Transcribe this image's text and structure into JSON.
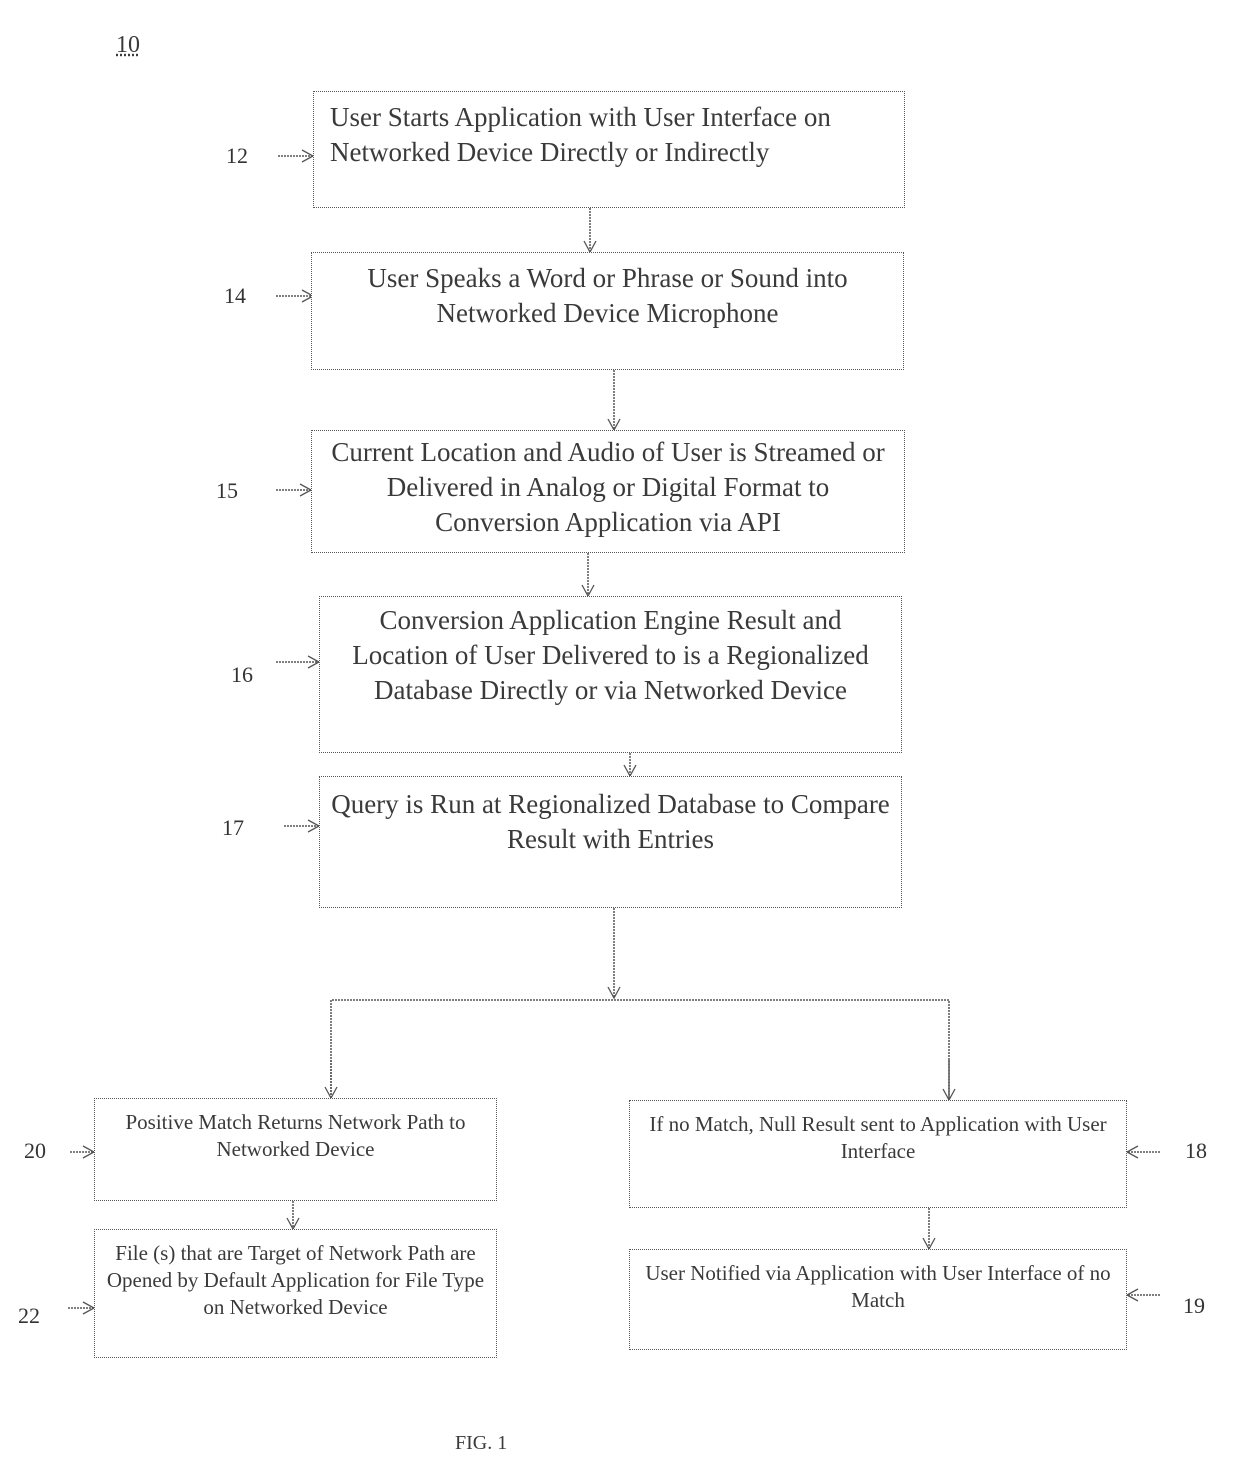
{
  "figure": {
    "number": "10",
    "caption": "FIG. 1"
  },
  "steps": {
    "s12": {
      "ref": "12",
      "text": "User Starts Application with User Interface on Networked Device Directly or Indirectly"
    },
    "s14": {
      "ref": "14",
      "text": "User Speaks a Word or Phrase or Sound into Networked Device Microphone"
    },
    "s15": {
      "ref": "15",
      "text": "Current Location and Audio of User is Streamed or Delivered in Analog or Digital Format to Conversion Application via API"
    },
    "s16": {
      "ref": "16",
      "text": "Conversion Application Engine Result and Location of User Delivered to is a Regionalized Database Directly or via Networked Device"
    },
    "s17": {
      "ref": "17",
      "text": "Query is Run at Regionalized Database to Compare Result with Entries"
    },
    "s20": {
      "ref": "20",
      "text": "Positive Match Returns Network Path to Networked Device"
    },
    "s22": {
      "ref": "22",
      "text": "File (s) that are Target of Network Path are Opened by Default Application for File Type on Networked Device"
    },
    "s18": {
      "ref": "18",
      "text": "If no Match, Null Result sent to Application with User Interface"
    },
    "s19": {
      "ref": "19",
      "text": "User Notified via Application with User Interface of no Match"
    }
  }
}
